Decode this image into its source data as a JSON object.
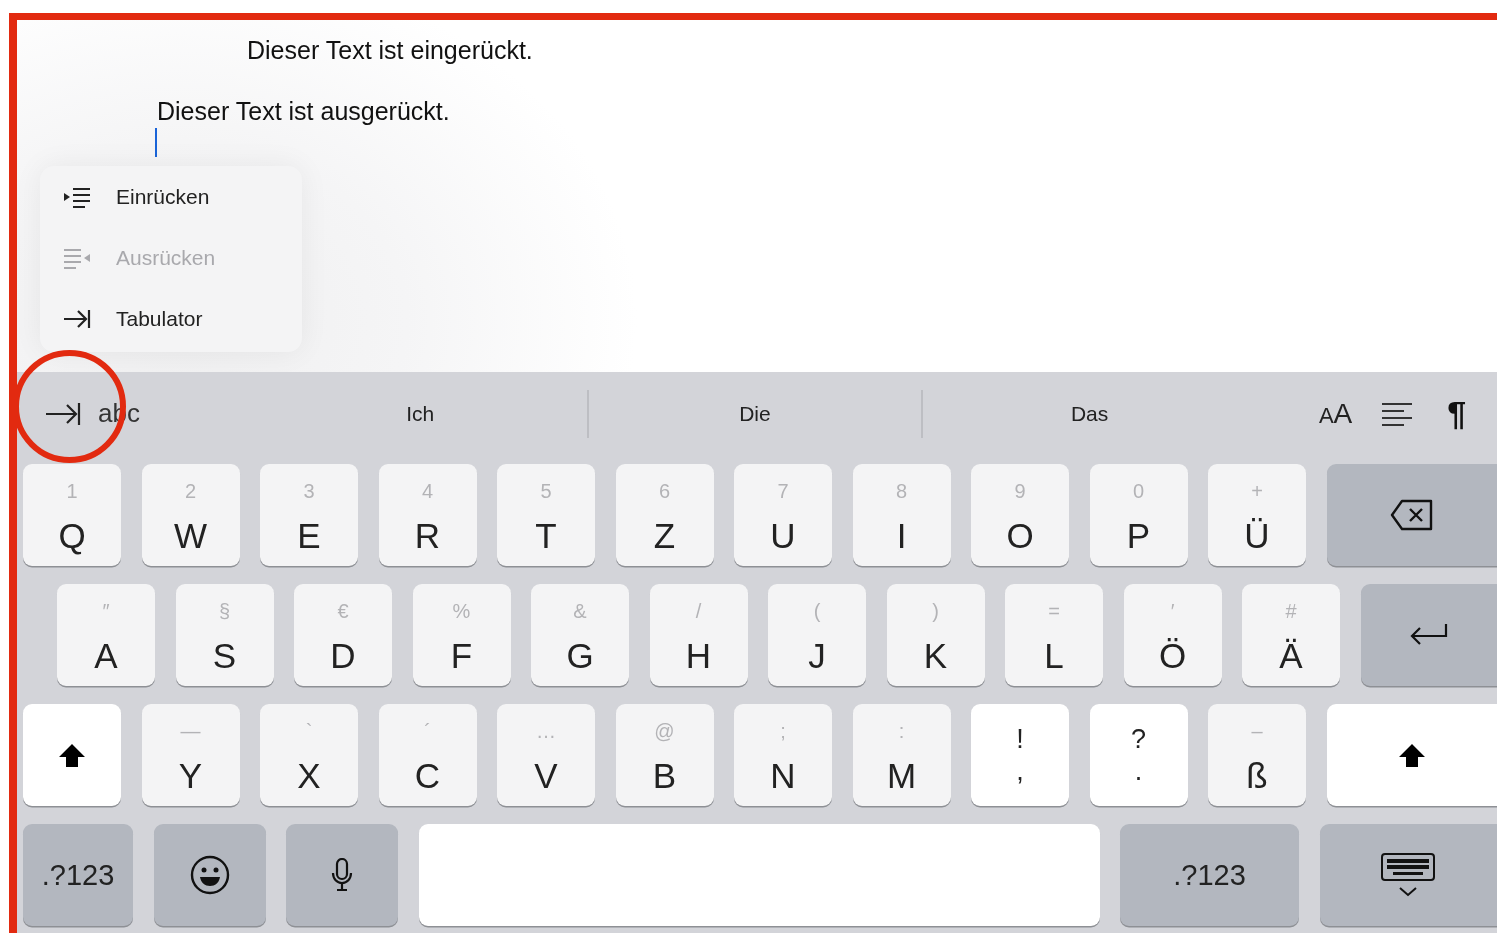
{
  "document": {
    "lines": [
      {
        "text": "Dieser Text ist eingerückt.",
        "kind": "indented"
      },
      {
        "text": "Dieser Text ist ausgerückt.",
        "kind": "outdented"
      }
    ]
  },
  "menu": {
    "items": [
      {
        "label": "Einrücken",
        "kind": "indent",
        "disabled": false
      },
      {
        "label": "Ausrücken",
        "kind": "outdent",
        "disabled": true
      },
      {
        "label": "Tabulator",
        "kind": "tab",
        "disabled": false
      }
    ]
  },
  "suggestion_bar": {
    "mode_label": "abc",
    "suggestions": [
      "Ich",
      "Die",
      "Das"
    ],
    "text_size_label": "AA",
    "paragraph_mark": "¶"
  },
  "keyboard": {
    "rows": [
      [
        {
          "kind": "letter",
          "label": "Q",
          "hint": "1"
        },
        {
          "kind": "letter",
          "label": "W",
          "hint": "2"
        },
        {
          "kind": "letter",
          "label": "E",
          "hint": "3"
        },
        {
          "kind": "letter",
          "label": "R",
          "hint": "4"
        },
        {
          "kind": "letter",
          "label": "T",
          "hint": "5"
        },
        {
          "kind": "letter",
          "label": "Z",
          "hint": "6"
        },
        {
          "kind": "letter",
          "label": "U",
          "hint": "7"
        },
        {
          "kind": "letter",
          "label": "I",
          "hint": "8"
        },
        {
          "kind": "letter",
          "label": "O",
          "hint": "9"
        },
        {
          "kind": "letter",
          "label": "P",
          "hint": "0"
        },
        {
          "kind": "letter",
          "label": "Ü",
          "hint": "+"
        },
        {
          "kind": "delete"
        }
      ],
      [
        {
          "kind": "letter",
          "label": "A",
          "hint": "″"
        },
        {
          "kind": "letter",
          "label": "S",
          "hint": "§"
        },
        {
          "kind": "letter",
          "label": "D",
          "hint": "€"
        },
        {
          "kind": "letter",
          "label": "F",
          "hint": "%"
        },
        {
          "kind": "letter",
          "label": "G",
          "hint": "&"
        },
        {
          "kind": "letter",
          "label": "H",
          "hint": "/"
        },
        {
          "kind": "letter",
          "label": "J",
          "hint": "("
        },
        {
          "kind": "letter",
          "label": "K",
          "hint": ")"
        },
        {
          "kind": "letter",
          "label": "L",
          "hint": "="
        },
        {
          "kind": "letter",
          "label": "Ö",
          "hint": "′"
        },
        {
          "kind": "letter",
          "label": "Ä",
          "hint": "#"
        },
        {
          "kind": "return"
        }
      ],
      [
        {
          "kind": "shift"
        },
        {
          "kind": "letter",
          "label": "Y",
          "hint": "—"
        },
        {
          "kind": "letter",
          "label": "X",
          "hint": "`"
        },
        {
          "kind": "letter",
          "label": "C",
          "hint": "´"
        },
        {
          "kind": "letter",
          "label": "V",
          "hint": "…"
        },
        {
          "kind": "letter",
          "label": "B",
          "hint": "@"
        },
        {
          "kind": "letter",
          "label": "N",
          "hint": ";"
        },
        {
          "kind": "letter",
          "label": "M",
          "hint": ":"
        },
        {
          "kind": "punct",
          "top": "!",
          "bottom": ","
        },
        {
          "kind": "punct",
          "top": "?",
          "bottom": "."
        },
        {
          "kind": "letter",
          "label": "ß",
          "hint": "–"
        },
        {
          "kind": "shift"
        }
      ],
      [
        {
          "kind": "symbols",
          "label": ".?123"
        },
        {
          "kind": "emoji"
        },
        {
          "kind": "dictation"
        },
        {
          "kind": "space"
        },
        {
          "kind": "symbols",
          "label": ".?123"
        },
        {
          "kind": "hide"
        }
      ]
    ]
  }
}
